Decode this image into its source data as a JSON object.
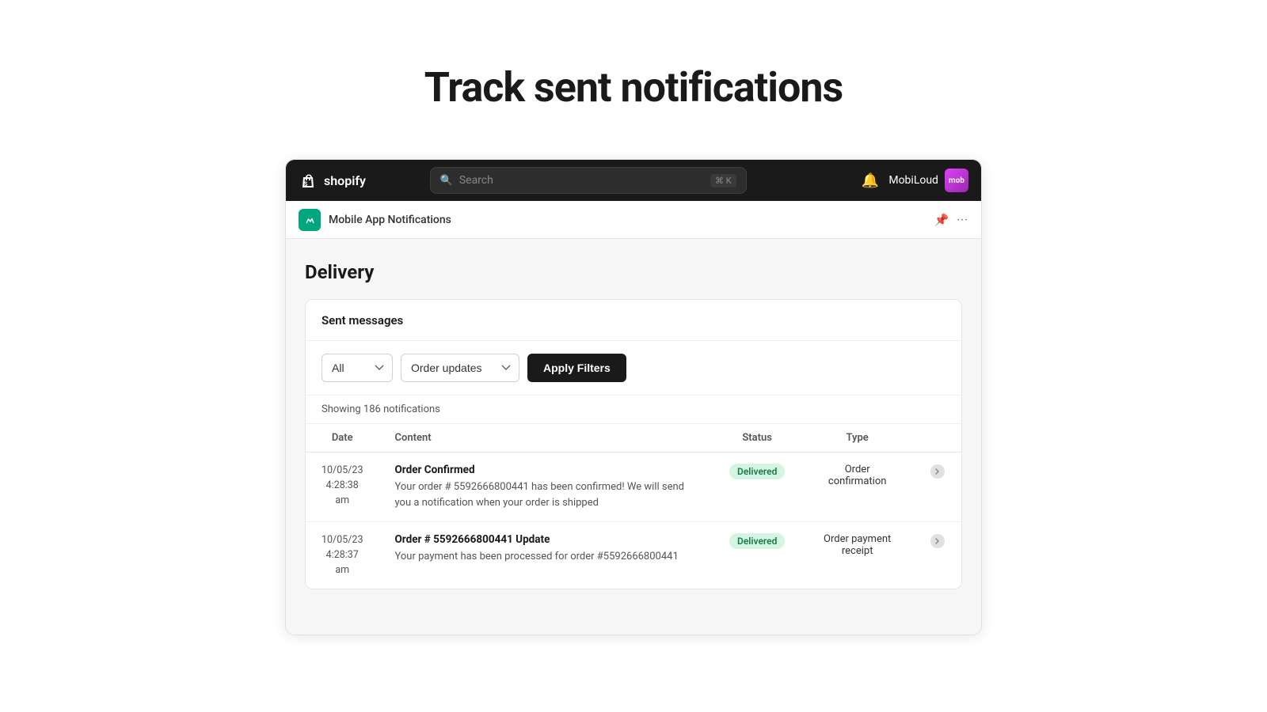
{
  "hero": {
    "title": "Track sent notifications"
  },
  "topbar": {
    "logo_text": "shopify",
    "search_placeholder": "Search",
    "search_shortcut": "⌘ K",
    "user_name": "MobiLoud",
    "user_initials": "mob",
    "bell_icon": "🔔"
  },
  "appbar": {
    "app_name": "Mobile App Notifications",
    "pin_icon": "📌",
    "more_icon": "···"
  },
  "main": {
    "delivery_title": "Delivery",
    "sent_messages_label": "Sent messages",
    "filter_all_label": "All",
    "filter_order_updates_label": "Order updates",
    "apply_filters_label": "Apply Filters",
    "showing_count": "Showing 186 notifications",
    "table": {
      "columns": [
        "Date",
        "Content",
        "Status",
        "Type"
      ],
      "rows": [
        {
          "date": "10/05/23\n4:28:38\nam",
          "content_title": "Order Confirmed",
          "content_body": "Your order # 5592666800441 has been confirmed! We will send you a notification when your order is shipped",
          "status": "Delivered",
          "type": "Order confirmation",
          "has_action": true
        },
        {
          "date": "10/05/23\n4:28:37\nam",
          "content_title": "Order # 5592666800441 Update",
          "content_body": "Your payment has been processed for order #5592666800441",
          "status": "Delivered",
          "type": "Order payment receipt",
          "has_action": true
        }
      ]
    }
  }
}
